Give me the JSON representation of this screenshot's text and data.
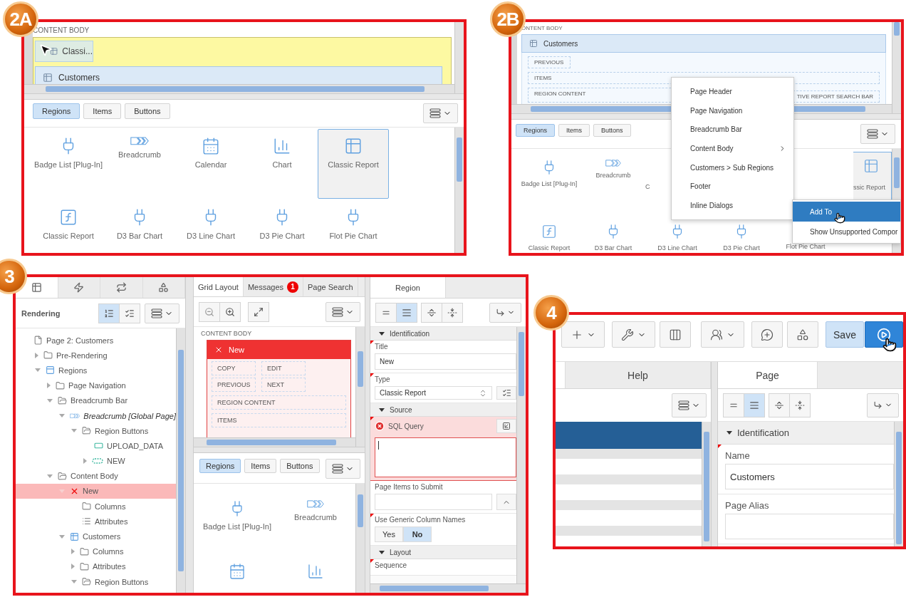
{
  "step_2a": {
    "badge": "2A",
    "canvas": {
      "section_label": "CONTENT BODY",
      "dragged_item": "Classi...",
      "region_title": "Customers"
    },
    "gallery": {
      "tabs": [
        {
          "label": "Regions",
          "selected": true
        },
        {
          "label": "Items",
          "selected": false
        },
        {
          "label": "Buttons",
          "selected": false
        }
      ],
      "rows": [
        [
          {
            "label": "Badge List [Plug-In]",
            "kind": "plugin",
            "selected": false
          },
          {
            "label": "Breadcrumb",
            "kind": "breadcrumb",
            "selected": false
          },
          {
            "label": "Calendar",
            "kind": "calendar",
            "selected": false
          },
          {
            "label": "Chart",
            "kind": "chart",
            "selected": false
          },
          {
            "label": "Classic Report",
            "kind": "report",
            "selected": true
          }
        ],
        [
          {
            "label": "Classic Report",
            "kind": "function",
            "selected": false
          },
          {
            "label": "D3 Bar Chart",
            "kind": "plugin",
            "selected": false
          },
          {
            "label": "D3 Line Chart",
            "kind": "plugin",
            "selected": false
          },
          {
            "label": "D3 Pie Chart",
            "kind": "plugin",
            "selected": false
          },
          {
            "label": "Flot Pie Chart",
            "kind": "plugin",
            "selected": false
          }
        ]
      ]
    }
  },
  "step_2b": {
    "badge": "2B",
    "canvas": {
      "section_label": "ONTENT BODY",
      "region_title": "Customers",
      "slots": [
        "PREVIOUS",
        "ITEMS",
        "REGION CONTENT",
        "TIVE REPORT SEARCH BAR"
      ]
    },
    "gallery": {
      "tabs": [
        {
          "label": "Regions",
          "selected": true
        },
        {
          "label": "Items",
          "selected": false
        },
        {
          "label": "Buttons",
          "selected": false
        }
      ],
      "rows": [
        [
          {
            "label": "Badge List [Plug-In]",
            "kind": "plugin",
            "selected": false
          },
          {
            "label": "Breadcrumb",
            "kind": "breadcrumb",
            "selected": false
          },
          {
            "label": "C",
            "kind": "cut-right",
            "selected": false
          },
          {
            "label": "ssic Report",
            "kind": "cut-left",
            "selected": true
          }
        ],
        [
          {
            "label": "Classic Report",
            "kind": "function",
            "selected": false
          },
          {
            "label": "D3 Bar Chart",
            "kind": "plugin",
            "selected": false
          },
          {
            "label": "D3 Line Chart",
            "kind": "plugin",
            "selected": false
          },
          {
            "label": "D3 Pie Chart",
            "kind": "plugin",
            "selected": false
          },
          {
            "label": "Flot Pie Chart",
            "kind": "covered",
            "selected": false
          }
        ]
      ]
    },
    "menu": {
      "items": [
        {
          "label": "Page Header",
          "submenu": false
        },
        {
          "label": "Page Navigation",
          "submenu": false
        },
        {
          "label": "Breadcrumb Bar",
          "submenu": false
        },
        {
          "label": "Content Body",
          "submenu": true
        },
        {
          "label": "Customers > Sub Regions",
          "submenu": false
        },
        {
          "label": "Footer",
          "submenu": false
        },
        {
          "label": "Inline Dialogs",
          "submenu": false
        }
      ]
    },
    "context_menu": {
      "items": [
        {
          "label": "Add To",
          "selected": true
        },
        {
          "label": "Show Unsupported Compor",
          "selected": false
        }
      ]
    }
  },
  "step_3": {
    "badge": "3",
    "left_pane": {
      "tabs": [
        {
          "selected": true
        },
        {
          "selected": false
        },
        {
          "selected": false
        },
        {
          "selected": false
        }
      ],
      "title": "Rendering",
      "view_toggles": [
        {
          "selected": true
        },
        {
          "selected": false
        }
      ],
      "tree": [
        {
          "label": "Page 2: Customers",
          "kind": "page",
          "selected": false,
          "children": [
            {
              "label": "Pre-Rendering",
              "kind": "folder",
              "expanded": false,
              "selected": false
            },
            {
              "label": "Regions",
              "kind": "region",
              "expanded": true,
              "selected": false,
              "children": [
                {
                  "label": "Page Navigation",
                  "kind": "folder",
                  "expanded": false,
                  "selected": false
                },
                {
                  "label": "Breadcrumb Bar",
                  "kind": "folder",
                  "expanded": true,
                  "selected": false,
                  "children": [
                    {
                      "label": "Breadcrumb [Global Page]",
                      "kind": "breadcrumb",
                      "expanded": true,
                      "shared": true,
                      "selected": false,
                      "children": [
                        {
                          "label": "Region Buttons",
                          "kind": "folder",
                          "expanded": true,
                          "selected": false,
                          "children": [
                            {
                              "label": "UPLOAD_DATA",
                              "kind": "button",
                              "selected": false
                            },
                            {
                              "label": "NEW",
                              "kind": "dashed-button",
                              "expanded": false,
                              "selected": false
                            }
                          ]
                        }
                      ]
                    }
                  ]
                },
                {
                  "label": "Content Body",
                  "kind": "folder",
                  "expanded": true,
                  "selected": false,
                  "children": [
                    {
                      "label": "New",
                      "kind": "error",
                      "expanded": true,
                      "selected": true,
                      "children": [
                        {
                          "label": "Columns",
                          "kind": "folder",
                          "selected": false
                        },
                        {
                          "label": "Attributes",
                          "kind": "list",
                          "selected": false
                        }
                      ]
                    },
                    {
                      "label": "Customers",
                      "kind": "report",
                      "expanded": true,
                      "selected": false,
                      "children": [
                        {
                          "label": "Columns",
                          "kind": "folder",
                          "expanded": false,
                          "selected": false
                        },
                        {
                          "label": "Attributes",
                          "kind": "folder",
                          "expanded": false,
                          "selected": false
                        },
                        {
                          "label": "Region Buttons",
                          "kind": "folder",
                          "expanded": true,
                          "selected": false
                        }
                      ]
                    }
                  ]
                }
              ]
            }
          ]
        }
      ]
    },
    "middle_pane": {
      "tabs": [
        {
          "label": "Grid Layout",
          "selected": true
        },
        {
          "label": "Messages",
          "count": "1",
          "selected": false
        },
        {
          "label": "Page Search",
          "selected": false
        }
      ],
      "canvas": {
        "section_label": "CONTENT BODY",
        "region_title": "New",
        "error": true,
        "slot_rows": [
          [
            "COPY",
            "EDIT"
          ],
          [
            "PREVIOUS",
            "NEXT"
          ],
          [
            "REGION CONTENT"
          ],
          [
            "ITEMS"
          ]
        ]
      },
      "gallery": {
        "tabs": [
          {
            "label": "Regions",
            "selected": true
          },
          {
            "label": "Items",
            "selected": false
          },
          {
            "label": "Buttons",
            "selected": false
          }
        ],
        "rows": [
          [
            {
              "label": "Badge List [Plug-In]",
              "kind": "plugin",
              "selected": false
            },
            {
              "label": "Breadcrumb",
              "kind": "breadcrumb",
              "selected": false
            }
          ],
          [
            {
              "kind": "calendar",
              "selected": false
            },
            {
              "kind": "chart",
              "selected": false
            }
          ]
        ]
      }
    },
    "right_pane": {
      "tab": {
        "label": "Region",
        "selected": true
      },
      "view_toggles": [
        {
          "selected": false
        },
        {
          "selected": true
        }
      ],
      "groups": [
        {
          "title": "Identification",
          "expanded": true,
          "properties": [
            {
              "kind": "text",
              "label": "Title",
              "value": "New",
              "required": true,
              "error": false
            },
            {
              "kind": "select",
              "label": "Type",
              "value": "Classic Report",
              "required": true,
              "error": false
            }
          ]
        },
        {
          "title": "Source",
          "expanded": true,
          "properties": [
            {
              "kind": "code",
              "label": "SQL Query",
              "required": true,
              "error": true
            },
            {
              "kind": "picker",
              "label": "Page Items to Submit",
              "required": false,
              "error": false
            },
            {
              "kind": "switch",
              "label": "Use Generic Column Names",
              "required": true,
              "error": false,
              "options": [
                {
                  "label": "Yes",
                  "selected": false
                },
                {
                  "label": "No",
                  "selected": true
                }
              ]
            }
          ]
        },
        {
          "title": "Layout",
          "expanded": true,
          "properties": [
            {
              "kind": "cut",
              "label": "Sequence",
              "required": true,
              "error": false
            }
          ]
        }
      ]
    }
  },
  "step_4": {
    "badge": "4",
    "toolbar": {
      "save_label": "Save"
    },
    "left_pane": {
      "tab": {
        "label": "Help",
        "selected": false
      }
    },
    "right_pane": {
      "tab": {
        "label": "Page",
        "selected": true
      },
      "view_toggles": [
        {
          "selected": false
        },
        {
          "selected": true
        }
      ],
      "groups": [
        {
          "title": "Identification",
          "expanded": true,
          "properties": [
            {
              "kind": "text",
              "label": "Name",
              "value": "Customers",
              "required": true,
              "error": false
            },
            {
              "kind": "text",
              "label": "Page Alias",
              "required": false,
              "error": false
            }
          ]
        }
      ]
    }
  }
}
